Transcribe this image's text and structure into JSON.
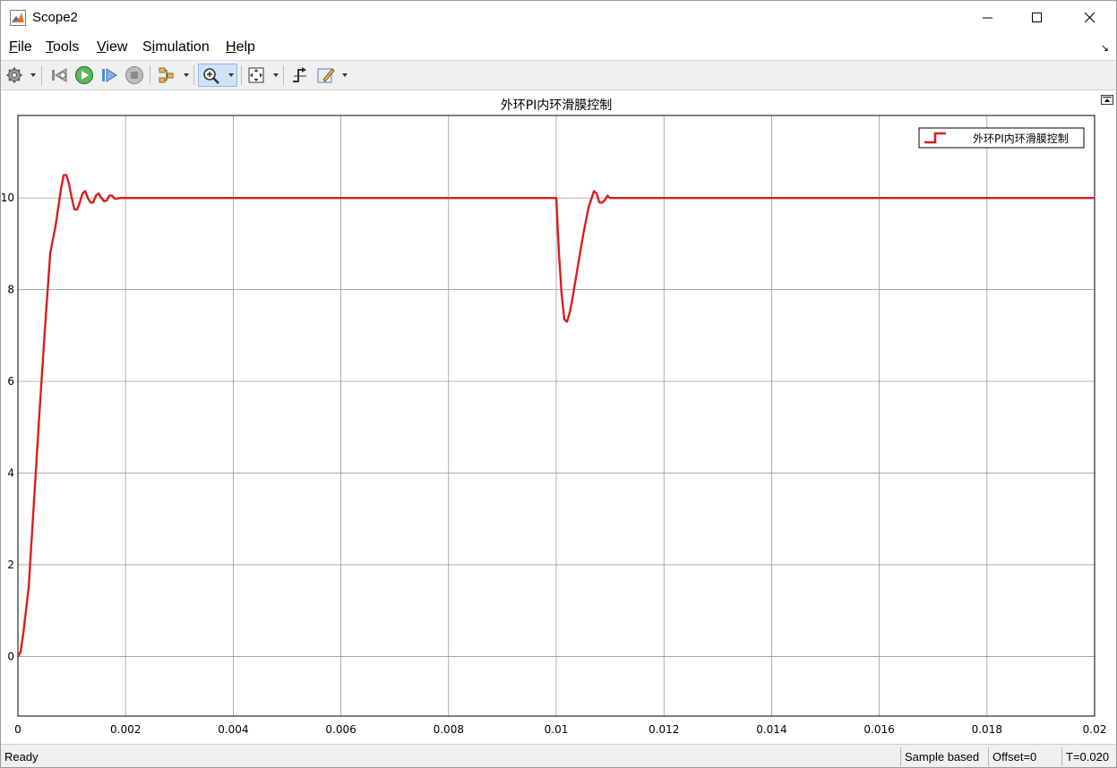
{
  "window": {
    "title": "Scope2"
  },
  "menu": {
    "items": [
      "File",
      "Tools",
      "View",
      "Simulation",
      "Help"
    ],
    "mnemonic_index": [
      0,
      0,
      0,
      1,
      0
    ]
  },
  "toolbar": {
    "icons": [
      "gear-icon",
      "step-back-icon",
      "run-icon",
      "step-forward-icon",
      "stop-icon",
      "signal-selector-icon",
      "zoom-in-icon",
      "autoscale-icon",
      "triggers-icon",
      "highlight-icon"
    ],
    "active": "zoom-in-icon"
  },
  "status": {
    "ready": "Ready",
    "sample": "Sample based",
    "offset": "Offset=0",
    "time": "T=0.020"
  },
  "colors": {
    "trace": "#d81e1e",
    "grid": "#8c8c8c",
    "axes": "#000000",
    "zoom_active_bg": "#cfe3f7"
  },
  "chart_data": {
    "type": "line",
    "title": "外环PI内环滑膜控制",
    "xlabel": "",
    "ylabel": "",
    "xlim": [
      0,
      0.02
    ],
    "ylim": [
      -1.3,
      11.8
    ],
    "xticks": [
      0,
      0.002,
      0.004,
      0.006,
      0.008,
      0.01,
      0.012,
      0.014,
      0.016,
      0.018,
      0.02
    ],
    "xtick_labels": [
      "0",
      "0.002",
      "0.004",
      "0.006",
      "0.008",
      "0.01",
      "0.012",
      "0.014",
      "0.016",
      "0.018",
      "0.02"
    ],
    "yticks": [
      0,
      2,
      4,
      6,
      8,
      10
    ],
    "ytick_labels": [
      "0",
      "2",
      "4",
      "6",
      "8",
      "10"
    ],
    "grid": true,
    "legend_position": "top-right",
    "series": [
      {
        "name": "外环PI内环滑膜控制",
        "x": [
          0,
          5e-05,
          0.0001,
          0.0002,
          0.0003,
          0.0004,
          0.0005,
          0.0006,
          0.0007,
          0.0008,
          0.00085,
          0.0009,
          0.00095,
          0.001,
          0.00105,
          0.0011,
          0.00115,
          0.0012,
          0.00125,
          0.0013,
          0.00135,
          0.0014,
          0.00145,
          0.0015,
          0.00155,
          0.0016,
          0.00165,
          0.0017,
          0.00175,
          0.0018,
          0.0019,
          0.002,
          0.004,
          0.006,
          0.008,
          0.01,
          0.01005,
          0.0101,
          0.01015,
          0.0102,
          0.01025,
          0.0103,
          0.0104,
          0.0105,
          0.0106,
          0.0107,
          0.01075,
          0.0108,
          0.01085,
          0.0109,
          0.01095,
          0.011,
          0.0112,
          0.012,
          0.014,
          0.016,
          0.018,
          0.02
        ],
        "y": [
          0,
          0.1,
          0.5,
          1.5,
          3.4,
          5.3,
          7.1,
          8.8,
          9.4,
          10.2,
          10.5,
          10.5,
          10.3,
          10.0,
          9.75,
          9.75,
          9.9,
          10.1,
          10.15,
          10.0,
          9.9,
          9.9,
          10.05,
          10.1,
          10.0,
          9.93,
          9.95,
          10.05,
          10.05,
          9.98,
          10.0,
          10.0,
          10.0,
          10.0,
          10.0,
          10.0,
          8.8,
          7.9,
          7.35,
          7.3,
          7.5,
          7.8,
          8.5,
          9.2,
          9.8,
          10.15,
          10.1,
          9.9,
          9.9,
          9.95,
          10.05,
          10.0,
          10.0,
          10.0,
          10.0,
          10.0,
          10.0,
          10.0
        ]
      }
    ]
  }
}
